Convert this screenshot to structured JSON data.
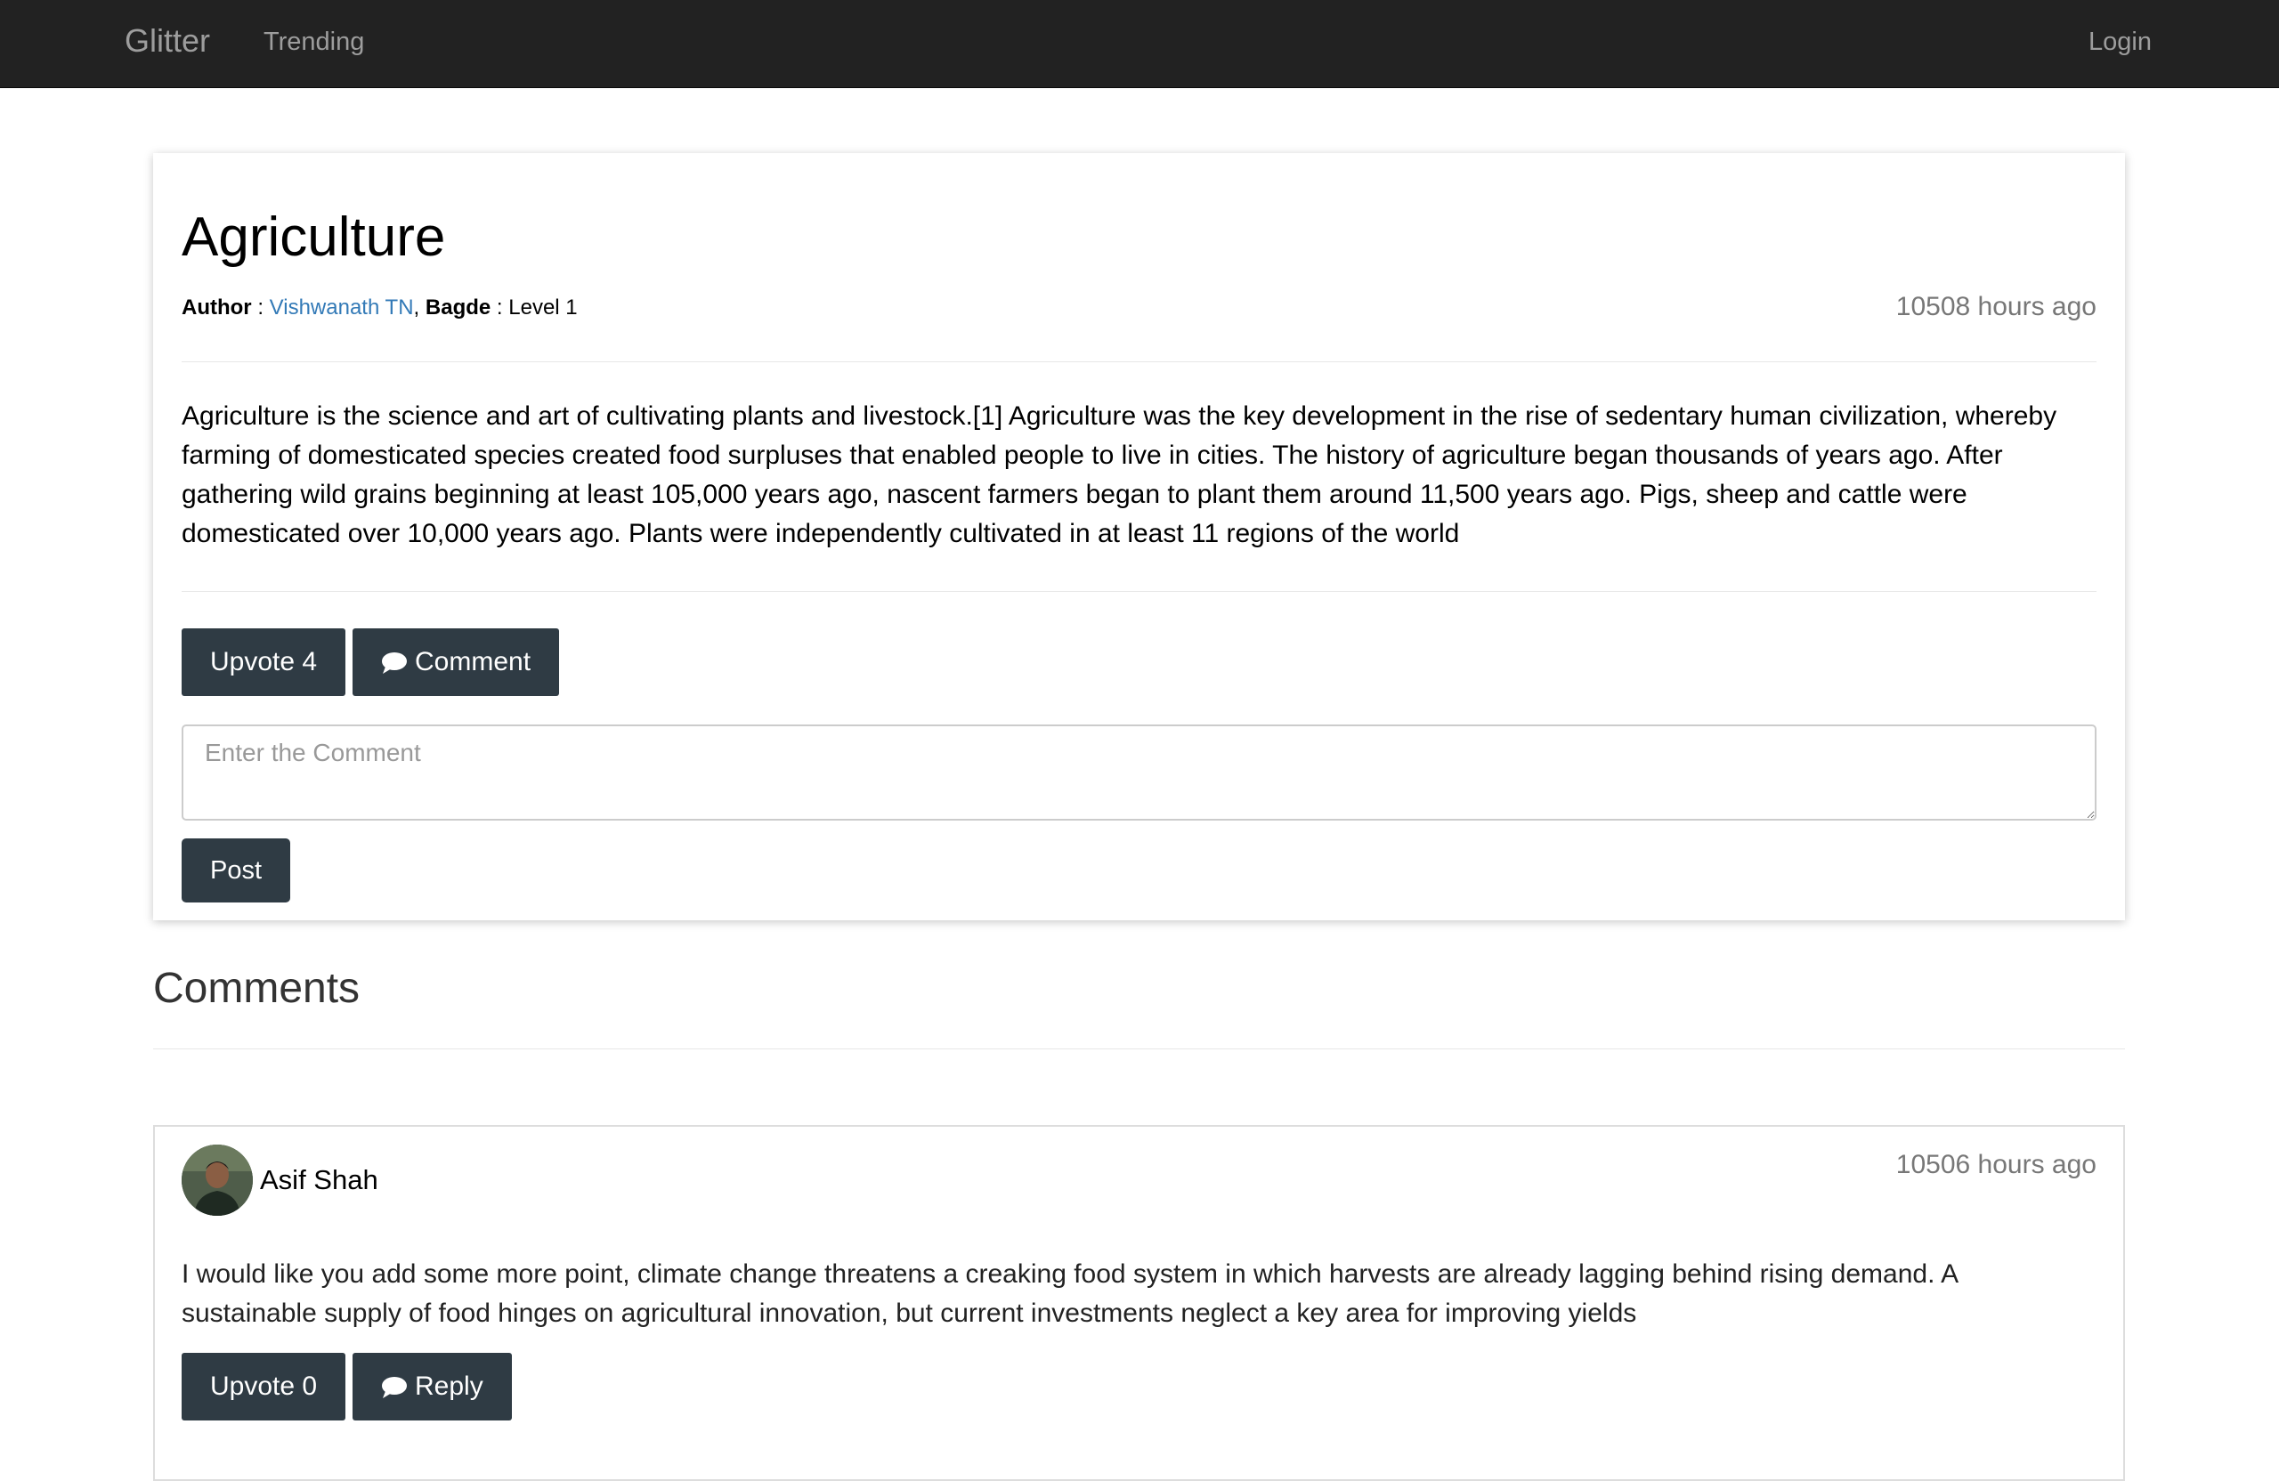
{
  "navbar": {
    "brand": "Glitter",
    "trending": "Trending",
    "login": "Login"
  },
  "post": {
    "title": "Agriculture",
    "author_label": "Author",
    "author_name": "Vishwanath TN",
    "badge_label": "Bagde",
    "badge_value": "Level 1",
    "time": "10508 hours ago",
    "body": "Agriculture is the science and art of cultivating plants and livestock.[1] Agriculture was the key development in the rise of sedentary human civilization, whereby farming of domesticated species created food surpluses that enabled people to live in cities. The history of agriculture began thousands of years ago. After gathering wild grains beginning at least 105,000 years ago, nascent farmers began to plant them around 11,500 years ago. Pigs, sheep and cattle were domesticated over 10,000 years ago. Plants were independently cultivated in at least 11 regions of the world",
    "upvote_label": "Upvote 4",
    "comment_label": "Comment",
    "comment_placeholder": "Enter the Comment",
    "post_label": "Post"
  },
  "comments_section": {
    "heading": "Comments",
    "items": [
      {
        "author": "Asif Shah",
        "time": "10506 hours ago",
        "text": "I would like you add some more point, climate change threatens a creaking food system in which harvests are already lagging behind rising demand. A sustainable supply of food hinges on agricultural innovation, but current investments neglect a key area for improving yields",
        "upvote_label": "Upvote 0",
        "reply_label": "Reply"
      }
    ]
  },
  "colors": {
    "navbar_bg": "#222222",
    "button_bg": "#2f3b44",
    "link": "#337ab7",
    "muted": "#777777"
  },
  "icons": {
    "comment": "speech-bubble-icon",
    "reply": "speech-bubble-icon"
  }
}
